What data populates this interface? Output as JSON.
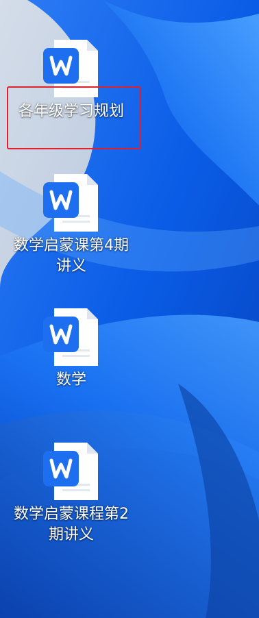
{
  "desktop": {
    "icons": [
      {
        "label": "各年级学习规划",
        "icon": "wps-word-document-icon",
        "selected": true
      },
      {
        "label": "数学启蒙课第4期讲义",
        "icon": "wps-word-document-icon",
        "selected": false
      },
      {
        "label": "数学",
        "icon": "wps-word-document-icon",
        "selected": false
      },
      {
        "label": "数学启蒙课程第2期讲义",
        "icon": "wps-word-document-icon",
        "selected": false
      }
    ]
  },
  "colors": {
    "accent": "#1e6ff0",
    "selection_border": "#e0202a",
    "wallpaper_light": "#c9d6e6",
    "wallpaper_blue": "#0a5ce6"
  }
}
